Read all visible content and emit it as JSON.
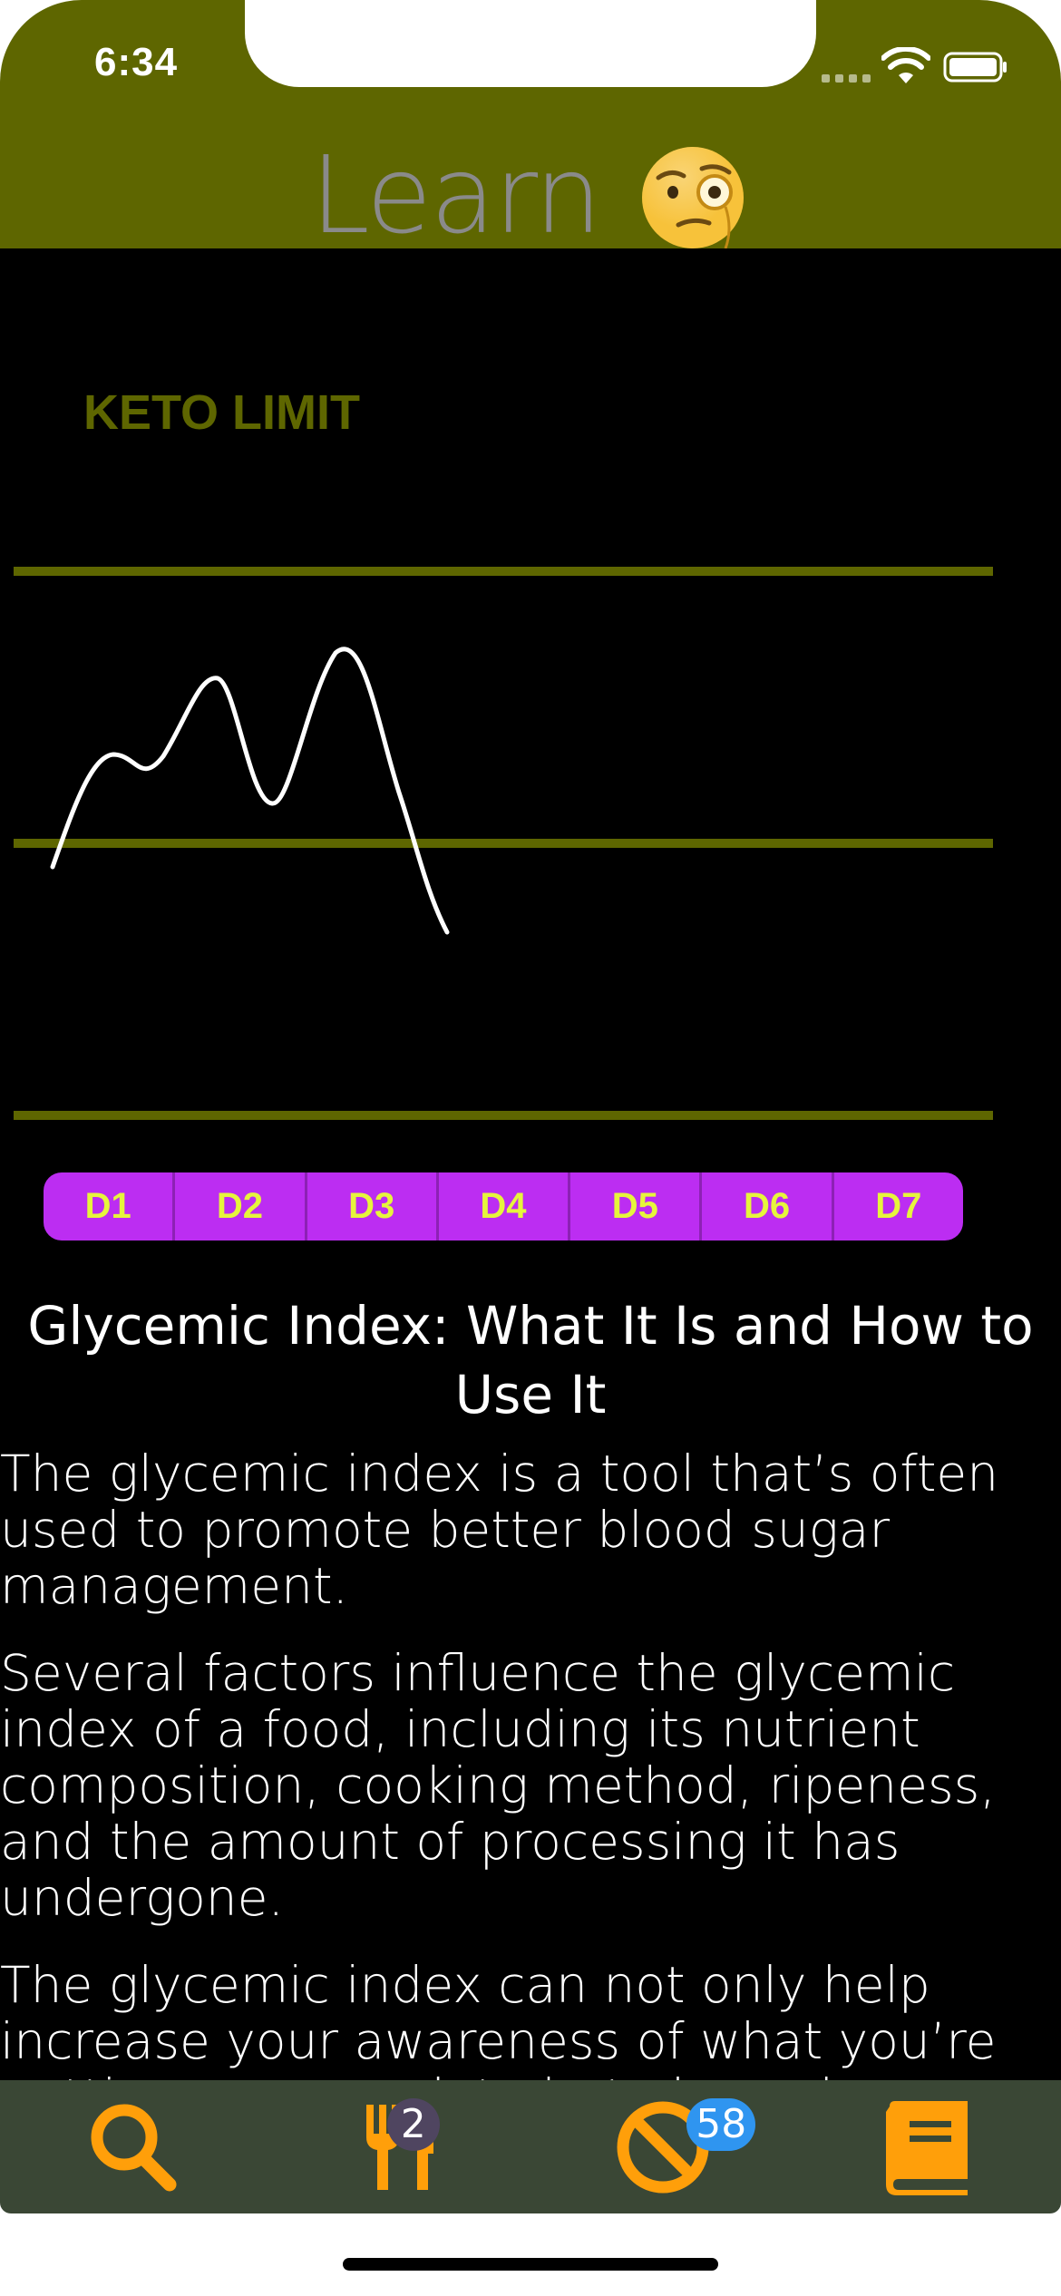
{
  "status_bar": {
    "time": "6:34"
  },
  "nav": {
    "title": "Learn",
    "title_icon": "monocle-face-icon"
  },
  "chart_data": {
    "type": "line",
    "title": "KETO LIMIT",
    "categories": [
      "D1",
      "D2",
      "D3",
      "D4",
      "D5",
      "D6",
      "D7"
    ],
    "grid": true,
    "colors": {
      "line": "#ffffff",
      "grid": "#5e6600",
      "label": "#5e6600"
    }
  },
  "days": [
    "D1",
    "D2",
    "D3",
    "D4",
    "D5",
    "D6",
    "D7"
  ],
  "article": {
    "title": "Glycemic Index: What It Is and How to Use It",
    "paragraphs": [
      "The glycemic index is a tool that’s often used to promote better blood sugar management.",
      "Several factors influence the glycemic index of a food, including its nutrient composition, cooking method, ripeness, and the amount of processing it has undergone.",
      "The glycemic index can not only help increase your awareness of what you’re putting on your plate but also enhance"
    ]
  },
  "tabbar": {
    "tabs": [
      {
        "icon": "search-icon"
      },
      {
        "icon": "fork-knife-icon",
        "badge": "2"
      },
      {
        "icon": "prohibited-icon",
        "badge": "58"
      },
      {
        "icon": "book-icon"
      }
    ]
  },
  "colors": {
    "header": "#5e6600",
    "accent": "#ff9f0a",
    "day_bar": "#bc2df2",
    "day_text": "#e6f53c",
    "tabbar": "#3a4735"
  }
}
